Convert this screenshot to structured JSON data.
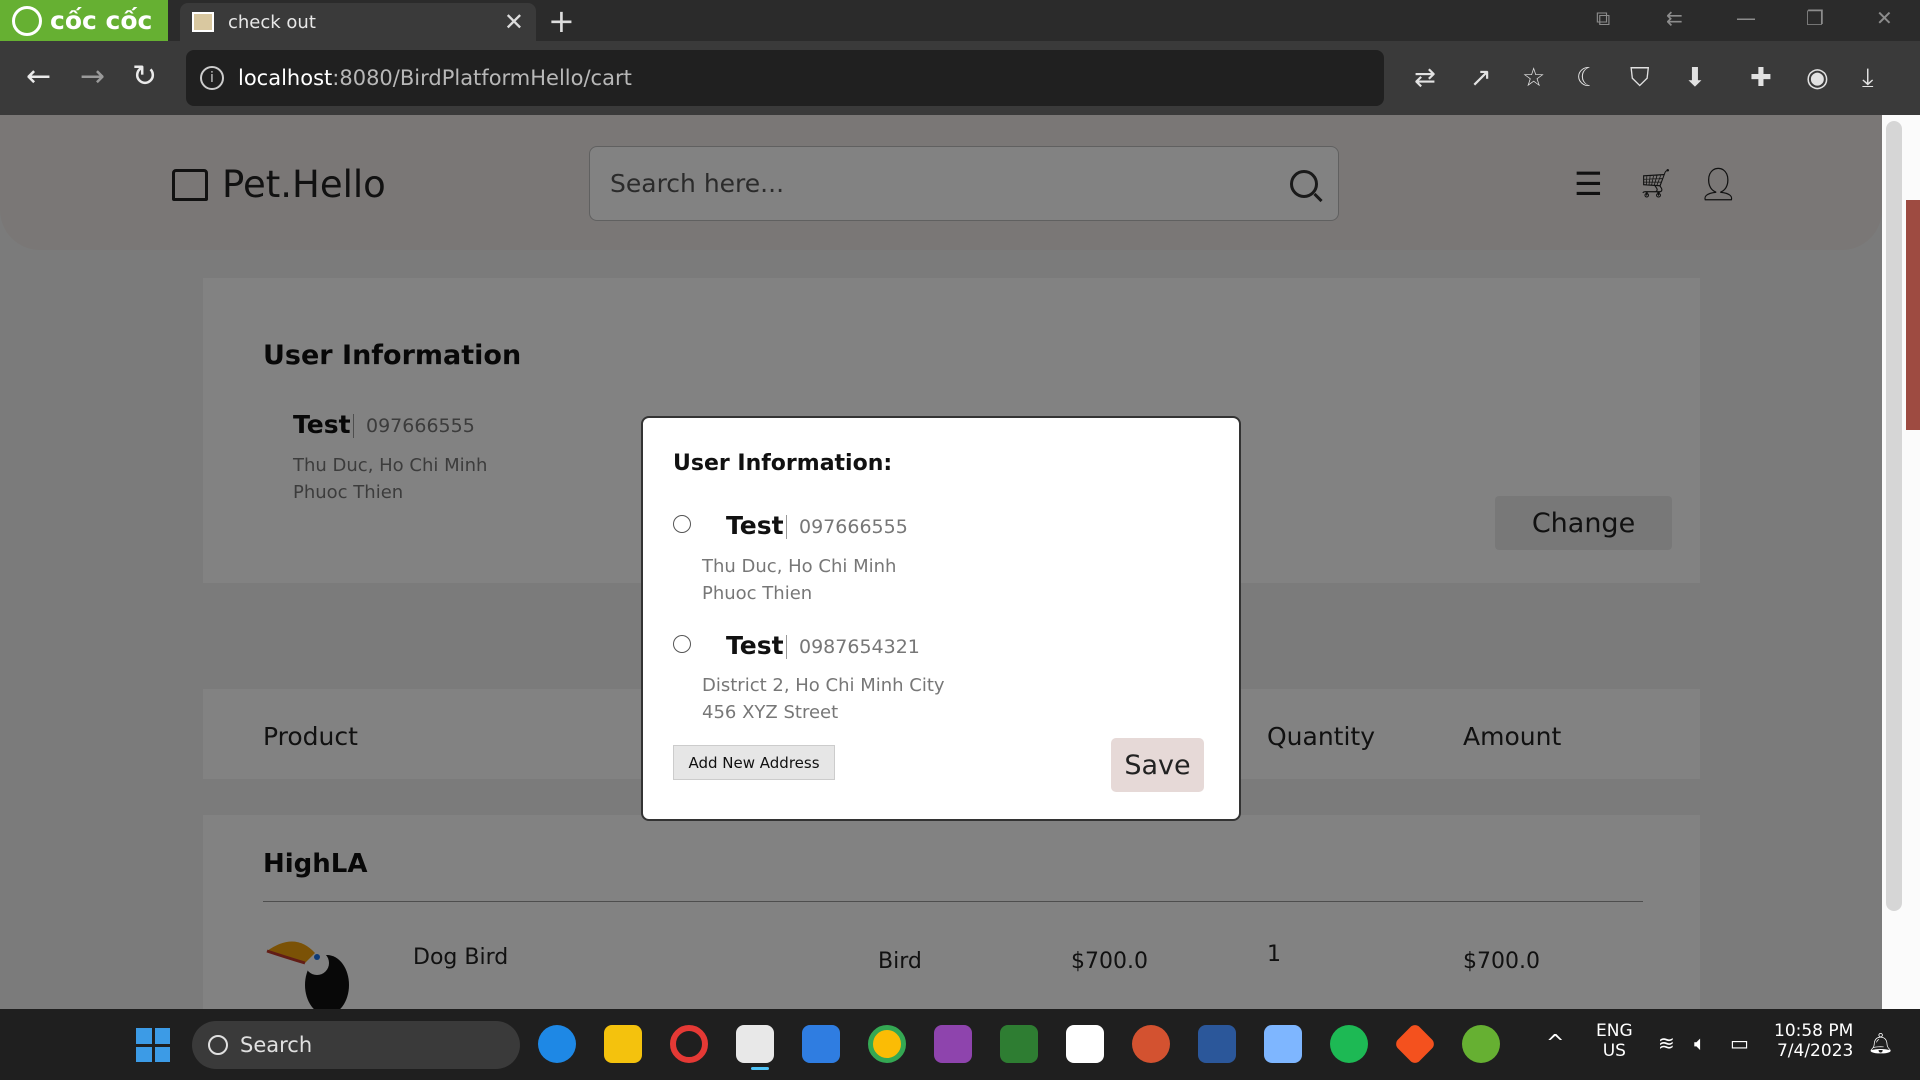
{
  "browser": {
    "brand": "cốc cốc",
    "tab": {
      "title": "check out"
    },
    "url": {
      "host": "localhost",
      "path": ":8080/BirdPlatformHello/cart"
    }
  },
  "site": {
    "logo_text": "Pet.Hello",
    "search_placeholder": "Search here..."
  },
  "user_info": {
    "title": "User Information",
    "name": "Test",
    "phone": "097666555",
    "address_line1": "Thu Duc, Ho Chi Minh",
    "address_line2": "Phuoc Thien",
    "change_label": "Change"
  },
  "table": {
    "headers": {
      "product": "Product",
      "quantity": "Quantity",
      "amount": "Amount"
    },
    "shop_name": "HighLA",
    "rows": [
      {
        "name": "Dog Bird",
        "category": "Bird",
        "price": "$700.0",
        "quantity": "1",
        "amount": "$700.0"
      }
    ]
  },
  "modal": {
    "title": "User Information:",
    "addresses": [
      {
        "name": "Test",
        "phone": "097666555",
        "line1": "Thu Duc, Ho Chi Minh",
        "line2": "Phuoc Thien"
      },
      {
        "name": "Test",
        "phone": "0987654321",
        "line1": "District 2, Ho Chi Minh City",
        "line2": "456 XYZ Street"
      }
    ],
    "add_label": "Add New Address",
    "save_label": "Save"
  },
  "taskbar": {
    "search_label": "Search",
    "lang_line1": "ENG",
    "lang_line2": "US",
    "time": "10:58 PM",
    "date": "7/4/2023"
  },
  "colors": {
    "brand_green": "#66b032",
    "header_bg": "#efeae7",
    "save_bg": "#e6d9d7",
    "scroll_thumb": "#9e4b41"
  }
}
